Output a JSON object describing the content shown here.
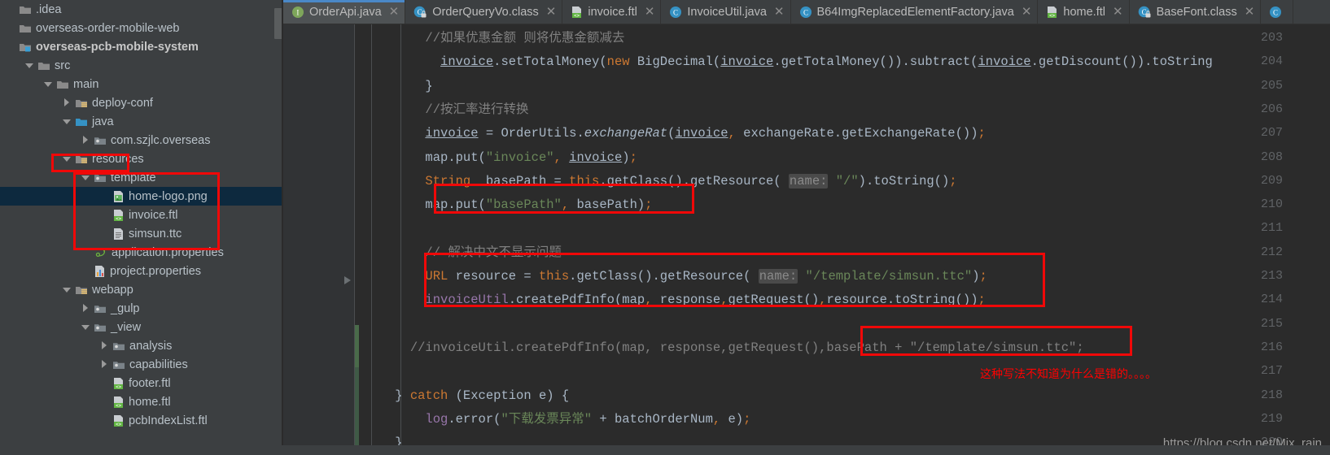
{
  "app": {
    "theme_bg": "#2b2b2b",
    "panel_bg": "#3c3f41",
    "accent": "#4a88c7",
    "selection_bg": "#0d293e",
    "annotation_color": "#ff0000"
  },
  "sidebar": {
    "items": [
      {
        "label": ".idea",
        "indent": 0,
        "arrow": "none",
        "icon": "folder-icon",
        "bold": false,
        "selected": false
      },
      {
        "label": "overseas-order-mobile-web",
        "indent": 0,
        "arrow": "none",
        "icon": "folder-icon",
        "bold": false,
        "selected": false
      },
      {
        "label": "overseas-pcb-mobile-system",
        "indent": 0,
        "arrow": "none",
        "icon": "module-folder-icon",
        "bold": true,
        "selected": false
      },
      {
        "label": "src",
        "indent": 1,
        "arrow": "down",
        "icon": "folder-icon",
        "bold": false,
        "selected": false
      },
      {
        "label": "main",
        "indent": 2,
        "arrow": "down",
        "icon": "folder-icon",
        "bold": false,
        "selected": false
      },
      {
        "label": "deploy-conf",
        "indent": 3,
        "arrow": "right",
        "icon": "resource-folder-icon",
        "bold": false,
        "selected": false
      },
      {
        "label": "java",
        "indent": 3,
        "arrow": "down",
        "icon": "source-folder-icon",
        "bold": false,
        "selected": false
      },
      {
        "label": "com.szjlc.overseas",
        "indent": 4,
        "arrow": "right",
        "icon": "package-icon",
        "bold": false,
        "selected": false
      },
      {
        "label": "resources",
        "indent": 3,
        "arrow": "down",
        "icon": "resource-folder-icon",
        "bold": false,
        "selected": false
      },
      {
        "label": "template",
        "indent": 4,
        "arrow": "down",
        "icon": "package-icon",
        "bold": false,
        "selected": false
      },
      {
        "label": "home-logo.png",
        "indent": 5,
        "arrow": "none",
        "icon": "image-file-icon",
        "bold": false,
        "selected": true
      },
      {
        "label": "invoice.ftl",
        "indent": 5,
        "arrow": "none",
        "icon": "ftl-file-icon",
        "bold": false,
        "selected": false
      },
      {
        "label": "simsun.ttc",
        "indent": 5,
        "arrow": "none",
        "icon": "generic-file-icon",
        "bold": false,
        "selected": false
      },
      {
        "label": "application.properties",
        "indent": 4,
        "arrow": "none",
        "icon": "spring-file-icon",
        "bold": false,
        "selected": false
      },
      {
        "label": "project.properties",
        "indent": 4,
        "arrow": "none",
        "icon": "properties-file-icon",
        "bold": false,
        "selected": false
      },
      {
        "label": "webapp",
        "indent": 3,
        "arrow": "down",
        "icon": "resource-folder-icon",
        "bold": false,
        "selected": false
      },
      {
        "label": "_gulp",
        "indent": 4,
        "arrow": "right",
        "icon": "package-icon",
        "bold": false,
        "selected": false
      },
      {
        "label": "_view",
        "indent": 4,
        "arrow": "down",
        "icon": "package-icon",
        "bold": false,
        "selected": false
      },
      {
        "label": "analysis",
        "indent": 5,
        "arrow": "right",
        "icon": "package-icon",
        "bold": false,
        "selected": false
      },
      {
        "label": "capabilities",
        "indent": 5,
        "arrow": "right",
        "icon": "package-icon",
        "bold": false,
        "selected": false
      },
      {
        "label": "footer.ftl",
        "indent": 5,
        "arrow": "none",
        "icon": "ftl-file-icon",
        "bold": false,
        "selected": false
      },
      {
        "label": "home.ftl",
        "indent": 5,
        "arrow": "none",
        "icon": "ftl-file-icon",
        "bold": false,
        "selected": false
      },
      {
        "label": "pcbIndexList.ftl",
        "indent": 5,
        "arrow": "none",
        "icon": "ftl-file-icon",
        "bold": false,
        "selected": false
      }
    ]
  },
  "tabs": [
    {
      "label": "OrderApi.java",
      "icon": "interface-icon",
      "active": true,
      "closable": true
    },
    {
      "label": "OrderQueryVo.class",
      "icon": "class-locked-icon",
      "active": false,
      "closable": true
    },
    {
      "label": "invoice.ftl",
      "icon": "ftl-file-icon",
      "active": false,
      "closable": true
    },
    {
      "label": "InvoiceUtil.java",
      "icon": "class-icon",
      "active": false,
      "closable": true
    },
    {
      "label": "B64ImgReplacedElementFactory.java",
      "icon": "class-icon",
      "active": false,
      "closable": true
    },
    {
      "label": "home.ftl",
      "icon": "ftl-file-icon",
      "active": false,
      "closable": true
    },
    {
      "label": "BaseFont.class",
      "icon": "class-locked-icon",
      "active": false,
      "closable": true
    }
  ],
  "editor": {
    "line_numbers": [
      "203",
      "204",
      "205",
      "206",
      "207",
      "208",
      "209",
      "210",
      "211",
      "212",
      "213",
      "214",
      "215",
      "216",
      "217",
      "218",
      "219",
      "220"
    ],
    "lines": [
      {
        "n": "203",
        "text": "        //如果优惠金额 则将优惠金额减去"
      },
      {
        "n": "204",
        "text": "          invoice.setTotalMoney(new BigDecimal(invoice.getTotalMoney()).subtract(invoice.getDiscount()).toString"
      },
      {
        "n": "205",
        "text": "        }"
      },
      {
        "n": "206",
        "text": "        //按汇率进行转换"
      },
      {
        "n": "207",
        "text": "        invoice = OrderUtils.exchangeRat(invoice, exchangeRate.getExchangeRate());"
      },
      {
        "n": "208",
        "text": "        map.put(\"invoice\", invoice);"
      },
      {
        "n": "209",
        "text": "        String  basePath = this.getClass().getResource( name: \"/\").toString();"
      },
      {
        "n": "210",
        "text": "        map.put(\"basePath\", basePath);"
      },
      {
        "n": "211",
        "text": ""
      },
      {
        "n": "212",
        "text": "        // 解决中文不显示问题"
      },
      {
        "n": "213",
        "text": "        URL resource = this.getClass().getResource( name: \"/template/simsun.ttc\");"
      },
      {
        "n": "214",
        "text": "        invoiceUtil.createPdfInfo(map, response,getRequest(),resource.toString());"
      },
      {
        "n": "215",
        "text": ""
      },
      {
        "n": "216",
        "text": "      //invoiceUtil.createPdfInfo(map, response,getRequest(),basePath + \"/template/simsun.ttc\";"
      },
      {
        "n": "217",
        "text": ""
      },
      {
        "n": "218",
        "text": "    } catch (Exception e) {"
      },
      {
        "n": "219",
        "text": "        log.error(\"下载发票异常\" + batchOrderNum, e);"
      },
      {
        "n": "220",
        "text": "    }"
      }
    ],
    "annotation_note": "这种写法不知道为什么是错的。。。。",
    "watermark": "https://blog.csdn.net/Mix_rain"
  }
}
